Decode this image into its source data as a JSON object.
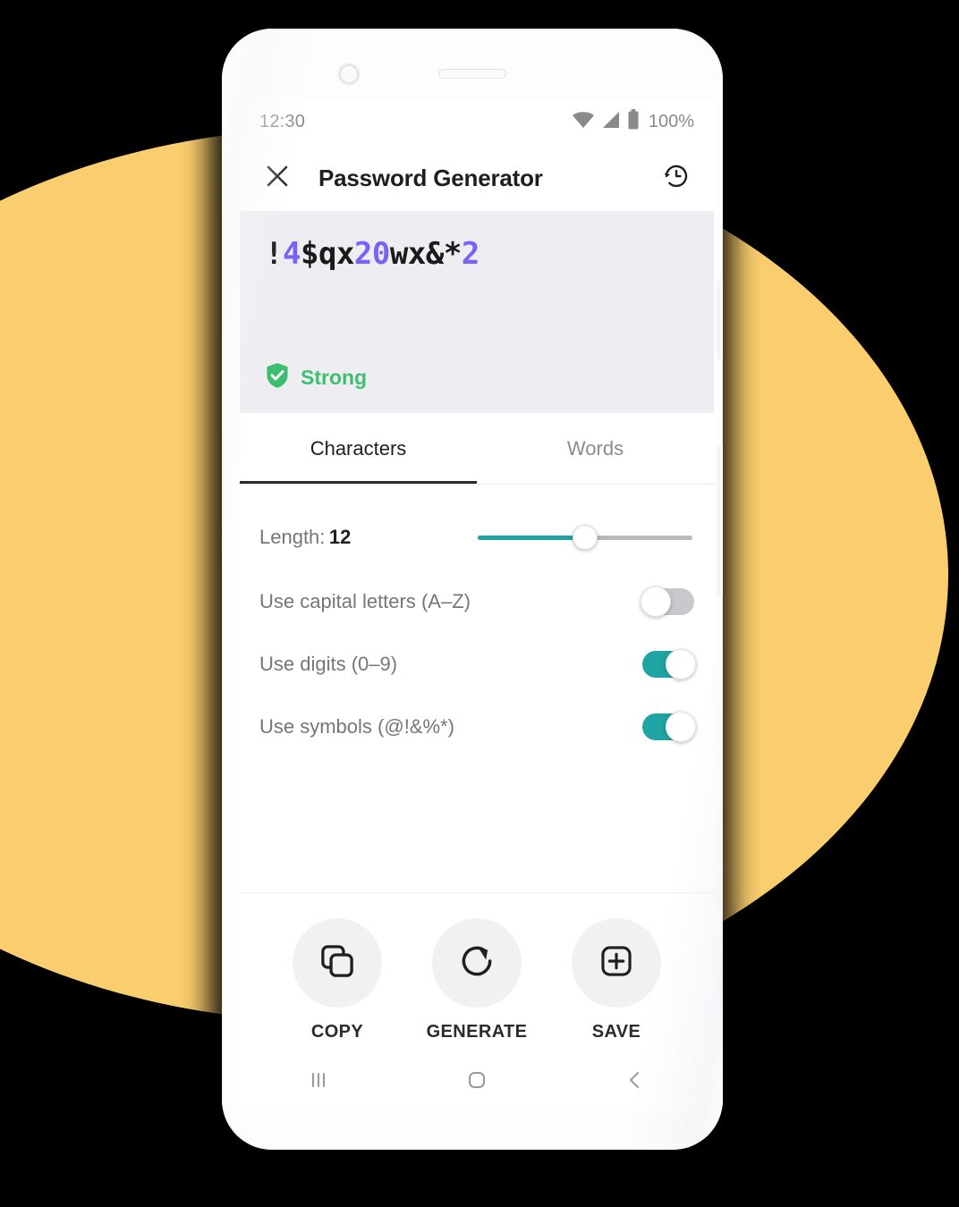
{
  "theme": {
    "background_yellow": "#FACD6E",
    "accent_teal": "#20A3A3",
    "digit_purple": "#7B61F8",
    "strength_green": "#3CBF6F",
    "panel_gray": "#EEEEF2",
    "phone_body": "#FDFDFD"
  },
  "status_bar": {
    "time": "12:30",
    "battery_percent": "100%",
    "wifi_icon": "wifi-icon",
    "signal_icon": "cellular-signal-icon",
    "battery_icon": "battery-full-icon"
  },
  "app_bar": {
    "close_icon": "close-icon",
    "title": "Password Generator",
    "history_icon": "history-icon"
  },
  "password_panel": {
    "password": "!4$qx20wx&*2",
    "characters": [
      {
        "ch": "!",
        "kind": "other"
      },
      {
        "ch": "4",
        "kind": "digit"
      },
      {
        "ch": "$",
        "kind": "other"
      },
      {
        "ch": "q",
        "kind": "other"
      },
      {
        "ch": "x",
        "kind": "other"
      },
      {
        "ch": "2",
        "kind": "digit"
      },
      {
        "ch": "0",
        "kind": "digit"
      },
      {
        "ch": "w",
        "kind": "other"
      },
      {
        "ch": "x",
        "kind": "other"
      },
      {
        "ch": "&",
        "kind": "other"
      },
      {
        "ch": "*",
        "kind": "other"
      },
      {
        "ch": "2",
        "kind": "digit"
      }
    ],
    "strength_label": "Strong",
    "strength_icon": "shield-check-icon"
  },
  "tabs": [
    {
      "label": "Characters",
      "active": true
    },
    {
      "label": "Words",
      "active": false
    }
  ],
  "options": {
    "length": {
      "label": "Length:",
      "value": "12",
      "slider_percent": 50,
      "min": 1,
      "max": 24
    },
    "toggles": [
      {
        "label": "Use capital letters (A–Z)",
        "on": false,
        "name": "toggle-capital-letters"
      },
      {
        "label": "Use digits (0–9)",
        "on": true,
        "name": "toggle-digits"
      },
      {
        "label": "Use symbols (@!&%*)",
        "on": true,
        "name": "toggle-symbols"
      }
    ]
  },
  "actions": [
    {
      "label": "COPY",
      "icon": "copy-icon"
    },
    {
      "label": "GENERATE",
      "icon": "refresh-icon"
    },
    {
      "label": "SAVE",
      "icon": "add-box-icon"
    }
  ],
  "nav_bar": {
    "recents_icon": "recents-icon",
    "home_icon": "home-icon",
    "back_icon": "back-icon"
  }
}
